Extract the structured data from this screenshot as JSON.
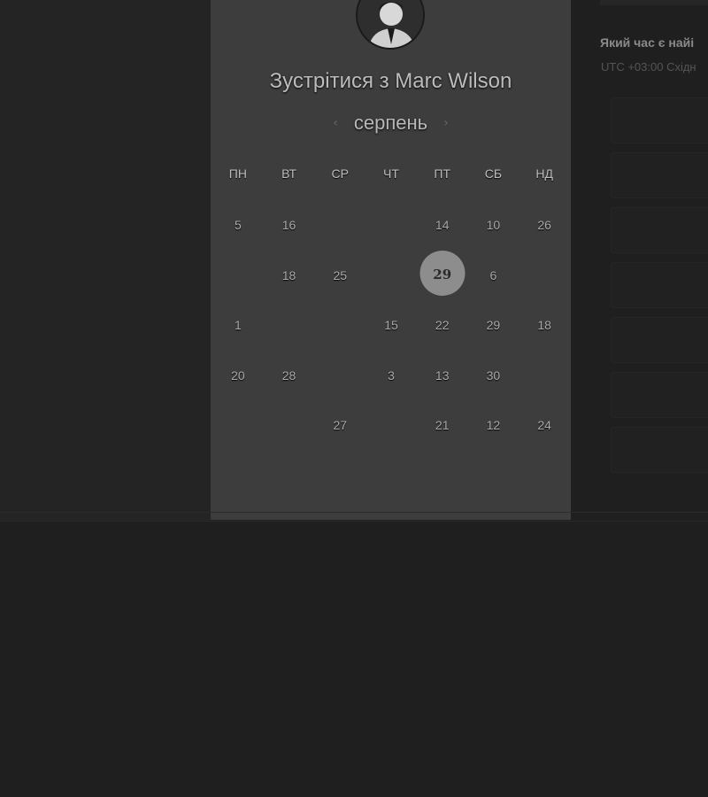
{
  "meeting": {
    "title": "Зустрітися з Marc Wilson"
  },
  "calendar": {
    "month": "серпень",
    "prev_icon": "chevron-left-icon",
    "next_icon": "chevron-right-icon",
    "weekdays": [
      "ПН",
      "ВТ",
      "СР",
      "ЧТ",
      "ПТ",
      "СБ",
      "НД"
    ],
    "selected_day": "29",
    "rows": [
      [
        {
          "d": "5",
          "a": true
        },
        {
          "d": "16",
          "a": true
        },
        {
          "d": "",
          "a": false
        },
        {
          "d": "",
          "a": false
        },
        {
          "d": "14",
          "a": true
        },
        {
          "d": "10",
          "a": true
        },
        {
          "d": "26",
          "a": true
        }
      ],
      [
        {
          "d": "",
          "a": false
        },
        {
          "d": "18",
          "a": true
        },
        {
          "d": "25",
          "a": true
        },
        {
          "d": "",
          "a": false
        },
        {
          "d": "29",
          "a": true,
          "sel": true
        },
        {
          "d": "6",
          "a": true
        },
        {
          "d": "",
          "a": false
        }
      ],
      [
        {
          "d": "1",
          "a": true
        },
        {
          "d": "",
          "a": false
        },
        {
          "d": "",
          "a": false
        },
        {
          "d": "15",
          "a": true
        },
        {
          "d": "22",
          "a": true
        },
        {
          "d": "29",
          "a": true
        },
        {
          "d": "18",
          "a": true
        }
      ],
      [
        {
          "d": "20",
          "a": true
        },
        {
          "d": "28",
          "a": true
        },
        {
          "d": "",
          "a": false
        },
        {
          "d": "3",
          "a": true
        },
        {
          "d": "13",
          "a": true
        },
        {
          "d": "30",
          "a": true
        },
        {
          "d": "",
          "a": false
        }
      ],
      [
        {
          "d": "",
          "a": false
        },
        {
          "d": "",
          "a": false
        },
        {
          "d": "27",
          "a": true
        },
        {
          "d": "",
          "a": false
        },
        {
          "d": "21",
          "a": true
        },
        {
          "d": "12",
          "a": true
        },
        {
          "d": "24",
          "a": true
        }
      ]
    ]
  },
  "side": {
    "question": "Який час є найі",
    "timezone": "UTC +03:00 Східн"
  },
  "colors": {
    "card_bg": "#3d3d3d",
    "page_bg": "#1f1f1f",
    "selected_circle": "#8d8d8d"
  }
}
